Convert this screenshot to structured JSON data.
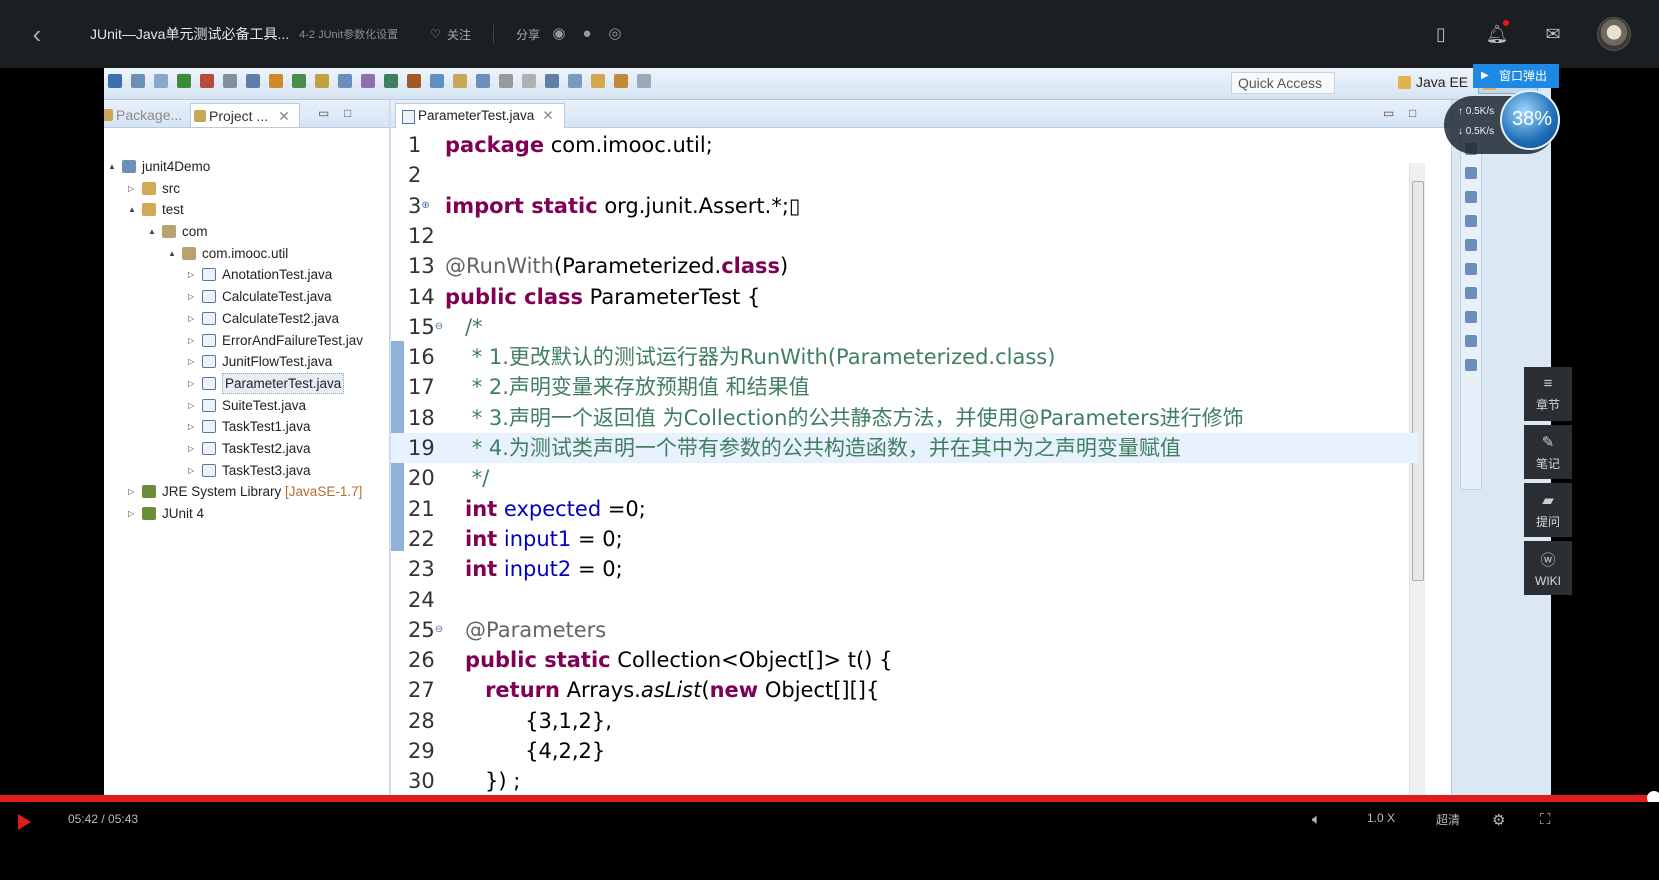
{
  "header": {
    "back_icon": "chevron-left-icon",
    "course_title": "JUnit—Java单元测试必备工具...",
    "chapter": "4-2 JUnit参数化设置",
    "follow_label": "关注",
    "share_label": "分享",
    "icons": [
      "mobile-icon",
      "bell-icon",
      "mail-icon",
      "avatar"
    ]
  },
  "eclipse": {
    "quick_access": "Quick Access",
    "perspective_javaee": "Java EE",
    "perspective_java": "Java",
    "explorer_tabs": [
      "Package...",
      "Project ..."
    ],
    "editor_tab": "ParameterTest.java",
    "tree": [
      {
        "label": "junit4Demo",
        "level": 0,
        "twisty": "▲",
        "icon": "proj"
      },
      {
        "label": "src",
        "level": 1,
        "twisty": "▷",
        "icon": "src"
      },
      {
        "label": "test",
        "level": 1,
        "twisty": "▲",
        "icon": "src"
      },
      {
        "label": "com",
        "level": 2,
        "twisty": "▲",
        "icon": "pkg"
      },
      {
        "label": "com.imooc.util",
        "level": 3,
        "twisty": "▲",
        "icon": "pkg"
      },
      {
        "label": "AnotationTest.java",
        "level": 4,
        "twisty": "▷",
        "icon": "java"
      },
      {
        "label": "CalculateTest.java",
        "level": 4,
        "twisty": "▷",
        "icon": "java"
      },
      {
        "label": "CalculateTest2.java",
        "level": 4,
        "twisty": "▷",
        "icon": "java"
      },
      {
        "label": "ErrorAndFailureTest.jav",
        "level": 4,
        "twisty": "▷",
        "icon": "java"
      },
      {
        "label": "JunitFlowTest.java",
        "level": 4,
        "twisty": "▷",
        "icon": "java"
      },
      {
        "label": "ParameterTest.java",
        "level": 4,
        "twisty": "▷",
        "icon": "java",
        "selected": true
      },
      {
        "label": "SuiteTest.java",
        "level": 4,
        "twisty": "▷",
        "icon": "java"
      },
      {
        "label": "TaskTest1.java",
        "level": 4,
        "twisty": "▷",
        "icon": "java"
      },
      {
        "label": "TaskTest2.java",
        "level": 4,
        "twisty": "▷",
        "icon": "java"
      },
      {
        "label": "TaskTest3.java",
        "level": 4,
        "twisty": "▷",
        "icon": "java"
      },
      {
        "label": "JRE System Library",
        "suffix": "[JavaSE-1.7]",
        "level": 1,
        "twisty": "▷",
        "icon": "lib"
      },
      {
        "label": "JUnit 4",
        "level": 1,
        "twisty": "▷",
        "icon": "lib"
      }
    ],
    "code": [
      {
        "n": "1",
        "parts": [
          [
            "kw",
            "package"
          ],
          [
            "",
            " com.imooc.util;"
          ]
        ]
      },
      {
        "n": "2",
        "parts": []
      },
      {
        "n": "3",
        "fold": "⊕",
        "parts": [
          [
            "kw",
            "import static"
          ],
          [
            "",
            " org.junit.Assert.*;▯"
          ]
        ]
      },
      {
        "n": "12",
        "parts": []
      },
      {
        "n": "13",
        "parts": [
          [
            "an",
            "@RunWith"
          ],
          [
            "",
            "(Parameterized."
          ],
          [
            "kw",
            "class"
          ],
          [
            "",
            ")"
          ]
        ]
      },
      {
        "n": "14",
        "parts": [
          [
            "kw",
            "public class"
          ],
          [
            "",
            " ParameterTest {"
          ]
        ]
      },
      {
        "n": "15",
        "fold": "⊖",
        "parts": [
          [
            "cm",
            "   /*"
          ]
        ]
      },
      {
        "n": "16",
        "parts": [
          [
            "cm",
            "    * 1.更改默认的测试运行器为RunWith(Parameterized.class)"
          ]
        ]
      },
      {
        "n": "17",
        "parts": [
          [
            "cm",
            "    * 2.声明变量来存放预期值 和结果值"
          ]
        ]
      },
      {
        "n": "18",
        "parts": [
          [
            "cm",
            "    * 3.声明一个返回值 为Collection的公共静态方法，并使用@Parameters进行修饰"
          ]
        ]
      },
      {
        "n": "19",
        "current": true,
        "parts": [
          [
            "cm",
            "    * 4.为测试类声明一个带有参数的公共构造函数，并在其中为之声明变量赋值"
          ]
        ]
      },
      {
        "n": "20",
        "parts": [
          [
            "cm",
            "    */"
          ]
        ]
      },
      {
        "n": "21",
        "parts": [
          [
            "",
            "   "
          ],
          [
            "kw",
            "int"
          ],
          [
            "fd",
            " expected"
          ],
          [
            "",
            " =0;"
          ]
        ]
      },
      {
        "n": "22",
        "parts": [
          [
            "",
            "   "
          ],
          [
            "kw",
            "int"
          ],
          [
            "fd",
            " input1"
          ],
          [
            "",
            " = 0;"
          ]
        ]
      },
      {
        "n": "23",
        "parts": [
          [
            "",
            "   "
          ],
          [
            "kw",
            "int"
          ],
          [
            "fd",
            " input2"
          ],
          [
            "",
            " = 0;"
          ]
        ]
      },
      {
        "n": "24",
        "parts": []
      },
      {
        "n": "25",
        "fold": "⊖",
        "parts": [
          [
            "an",
            "   @Parameters"
          ]
        ]
      },
      {
        "n": "26",
        "parts": [
          [
            "",
            "   "
          ],
          [
            "kw",
            "public static"
          ],
          [
            "",
            " Collection<Object[]> t() {"
          ]
        ]
      },
      {
        "n": "27",
        "parts": [
          [
            "",
            "      "
          ],
          [
            "kw",
            "return"
          ],
          [
            "",
            " Arrays."
          ],
          [
            "it",
            "asList"
          ],
          [
            "",
            "("
          ],
          [
            "kw",
            "new"
          ],
          [
            "",
            " Object[][]{"
          ]
        ]
      },
      {
        "n": "28",
        "parts": [
          [
            "",
            "            {3,1,2},"
          ]
        ]
      },
      {
        "n": "29",
        "parts": [
          [
            "",
            "            {4,2,2}"
          ]
        ]
      },
      {
        "n": "30",
        "parts": [
          [
            "",
            "      }) ;"
          ]
        ]
      }
    ]
  },
  "overlay": {
    "popout_label": "窗口弹出",
    "speed_up": "0.5K/s",
    "speed_down": "0.5K/s",
    "percent": "38%",
    "side_buttons": [
      {
        "label": "章节",
        "icon": "list-icon"
      },
      {
        "label": "笔记",
        "icon": "pencil-icon"
      },
      {
        "label": "提问",
        "icon": "comment-icon"
      },
      {
        "label": "WIKI",
        "icon": "wiki-icon"
      }
    ]
  },
  "player": {
    "time": "05:42 / 05:43",
    "progress": 0.997,
    "speed": "1.0 X",
    "quality": "超清",
    "icons": [
      "play-icon",
      "volume-icon",
      "settings-icon",
      "fullscreen-icon"
    ]
  }
}
